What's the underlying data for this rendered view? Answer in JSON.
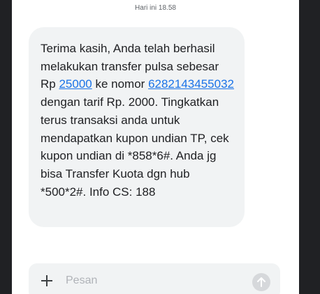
{
  "conversation": {
    "timestamp": "Hari ini 18.58",
    "message": {
      "part1": "Terima kasih, Anda telah berhasil melakukan transfer pulsa sebesar Rp ",
      "amount_link": "25000",
      "part2": " ke nomor ",
      "number_link": "6282143455032",
      "part3": " dengan tarif Rp. 2000. Tingkatkan terus transaksi anda untuk mendapatkan kupon undian TP, cek kupon undian di *858*6#. Anda jg bisa Transfer Kuota dgn hub *500*2#. Info CS: 188"
    }
  },
  "compose": {
    "placeholder": "Pesan",
    "attach_icon": "plus-icon",
    "send_icon": "arrow-up-icon"
  },
  "colors": {
    "link": "#1a73e8",
    "bubble": "#f1f3f4",
    "send_disabled": "#d6d8db"
  }
}
